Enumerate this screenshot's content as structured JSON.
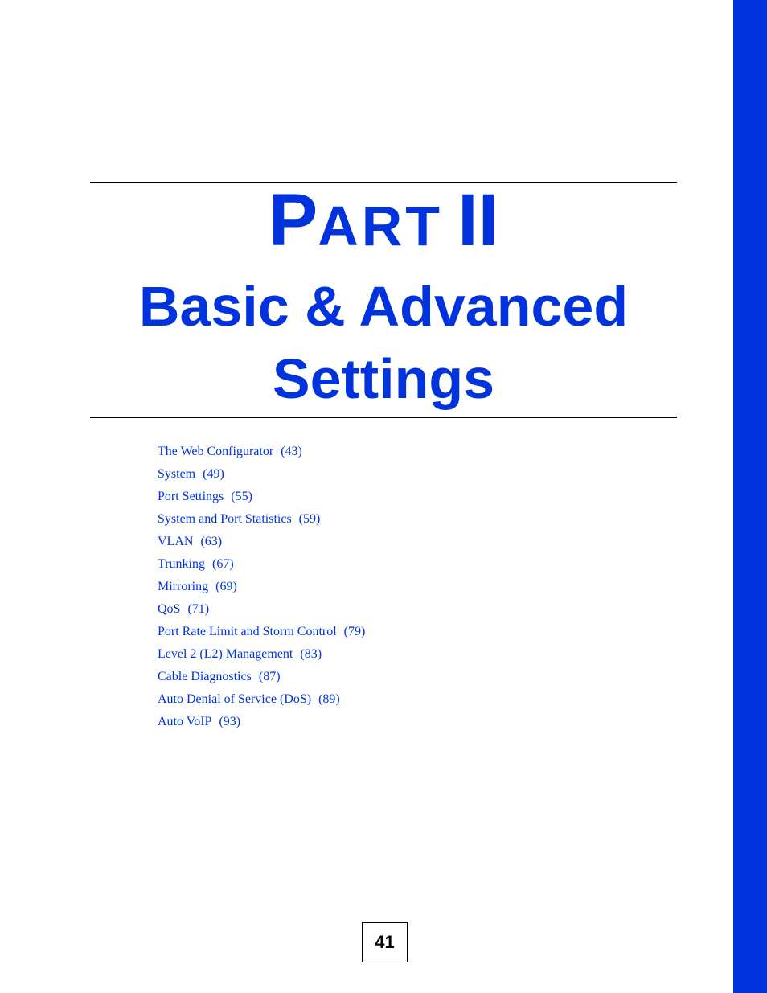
{
  "colors": {
    "accent": "#0033dd",
    "text": "#000000"
  },
  "part": {
    "first_letter": "P",
    "rest_letters": "ART",
    "numeral": "II"
  },
  "chapter_title": {
    "line1": "Basic & Advanced",
    "line2": "Settings"
  },
  "toc": [
    {
      "title": "The Web Configurator",
      "page": "(43)"
    },
    {
      "title": "System",
      "page": "(49)"
    },
    {
      "title": "Port Settings",
      "page": "(55)"
    },
    {
      "title": "System and Port Statistics",
      "page": "(59)"
    },
    {
      "title": "VLAN",
      "page": "(63)"
    },
    {
      "title": "Trunking",
      "page": "(67)"
    },
    {
      "title": "Mirroring",
      "page": "(69)"
    },
    {
      "title": "QoS",
      "page": "(71)"
    },
    {
      "title": "Port Rate Limit and Storm Control",
      "page": "(79)"
    },
    {
      "title": "Level 2 (L2) Management",
      "page": "(83)"
    },
    {
      "title": "Cable Diagnostics",
      "page": "(87)"
    },
    {
      "title": "Auto Denial of Service (DoS)",
      "page": "(89)"
    },
    {
      "title": "Auto VoIP",
      "page": "(93)"
    }
  ],
  "page_number": "41"
}
